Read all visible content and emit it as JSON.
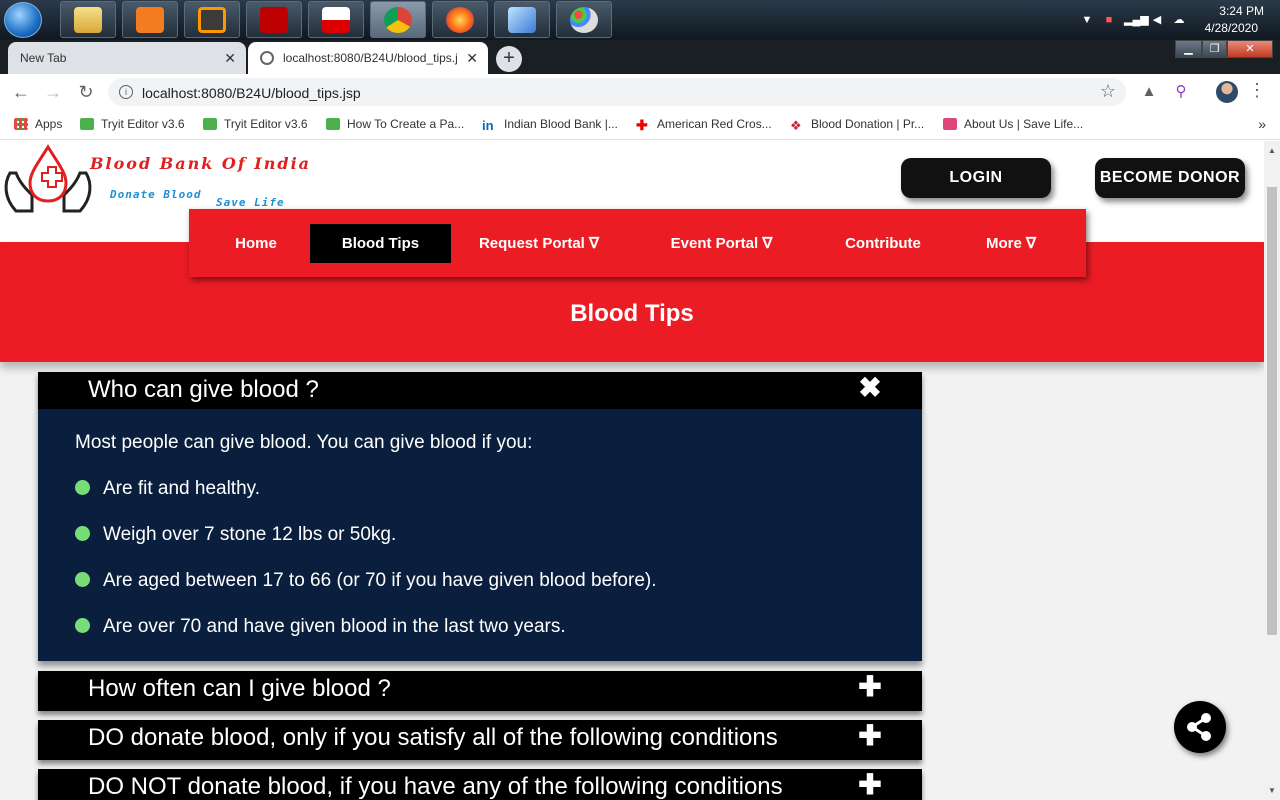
{
  "taskbar": {
    "apps": [
      {
        "name": "file-explorer",
        "active": false
      },
      {
        "name": "xampp",
        "active": false
      },
      {
        "name": "sublime-text",
        "active": false
      },
      {
        "name": "filezilla",
        "active": false
      },
      {
        "name": "ms-project",
        "active": false
      },
      {
        "name": "chrome",
        "active": true
      },
      {
        "name": "firefox",
        "active": false
      },
      {
        "name": "virtualbox",
        "active": false
      },
      {
        "name": "paint",
        "active": false
      }
    ],
    "clock_time": "3:24 PM",
    "clock_date": "4/28/2020"
  },
  "browser": {
    "tabs": [
      {
        "title": "New Tab"
      },
      {
        "title": "localhost:8080/B24U/blood_tips.j"
      }
    ],
    "url": "localhost:8080/B24U/blood_tips.jsp",
    "bookmarks": [
      {
        "label": "Apps",
        "icon": "apps-grid-icon"
      },
      {
        "label": "Tryit Editor v3.6",
        "icon": "w3schools-icon"
      },
      {
        "label": "Tryit Editor v3.6",
        "icon": "w3schools-icon"
      },
      {
        "label": "How To Create a Pa...",
        "icon": "w3schools-icon"
      },
      {
        "label": "Indian Blood Bank |...",
        "icon": "linkedin-icon"
      },
      {
        "label": "American Red Cros...",
        "icon": "red-cross-icon"
      },
      {
        "label": "Blood Donation | Pr...",
        "icon": "blood-drop-icon"
      },
      {
        "label": "About Us | Save Life...",
        "icon": "heart-icon"
      }
    ],
    "more_glyph": "»"
  },
  "site": {
    "logo": {
      "title": "Blood Bank Of India",
      "sub1": "Donate Blood",
      "sub2": "Save Life"
    },
    "login_label": "LOGIN",
    "donor_label": "BECOME DONOR",
    "nav": [
      {
        "label": "Home",
        "active": false
      },
      {
        "label": "Blood Tips",
        "active": true
      },
      {
        "label": "Request Portal ∇",
        "active": false
      },
      {
        "label": "Event Portal ∇",
        "active": false
      },
      {
        "label": "Contribute",
        "active": false
      },
      {
        "label": "More ∇",
        "active": false
      }
    ],
    "heading": "Blood Tips",
    "accordion": [
      {
        "title": "Who can give blood ?",
        "expanded": true,
        "intro": "Most people can give blood. You can give blood if you:",
        "items": [
          "Are fit and healthy.",
          "Weigh over 7 stone 12 lbs or 50kg.",
          "Are aged between 17 to 66 (or 70 if you have given blood before).",
          "Are over 70 and have given blood in the last two years."
        ]
      },
      {
        "title": "How often can I give blood ?",
        "expanded": false
      },
      {
        "title": "DO donate blood, only if you satisfy all of the following conditions",
        "expanded": false
      },
      {
        "title": "DO NOT donate blood, if you have any of the following conditions",
        "expanded": false
      }
    ],
    "toggle_expanded": "✖",
    "toggle_collapsed": "✚"
  },
  "colors": {
    "brand_red": "#ec1c24",
    "panel_navy": "#0a1f3d",
    "bullet_green": "#77dd77"
  }
}
